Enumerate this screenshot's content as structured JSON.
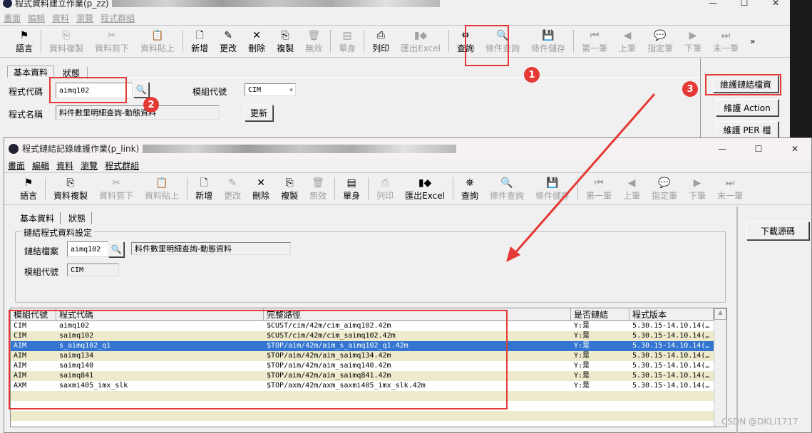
{
  "back_window": {
    "title": "程式資料建立作業(p_zz)",
    "menu": [
      "畫面",
      "編輯",
      "資料",
      "瀏覽",
      "程式群組"
    ],
    "toolbar": [
      {
        "icon": "flag-icon",
        "glyph": "⚑",
        "label": "語言",
        "enabled": true
      },
      {
        "sep": true
      },
      {
        "icon": "copy-data-icon",
        "glyph": "⎘",
        "label": "資料複製",
        "enabled": false
      },
      {
        "icon": "cut-icon",
        "glyph": "✂",
        "label": "資料剪下",
        "enabled": false
      },
      {
        "icon": "paste-icon",
        "glyph": "📋",
        "label": "資料貼上",
        "enabled": false
      },
      {
        "sep": true
      },
      {
        "icon": "new-icon",
        "glyph": "🗋",
        "label": "新增",
        "enabled": true
      },
      {
        "icon": "pencil-icon",
        "glyph": "✎",
        "label": "更改",
        "enabled": true
      },
      {
        "icon": "delete-icon",
        "glyph": "✕",
        "label": "刪除",
        "enabled": true
      },
      {
        "icon": "duplicate-icon",
        "glyph": "⎘",
        "label": "複製",
        "enabled": true
      },
      {
        "icon": "trash-icon",
        "glyph": "🗑",
        "label": "無效",
        "enabled": false
      },
      {
        "sep": true
      },
      {
        "icon": "form-icon",
        "glyph": "▤",
        "label": "單身",
        "enabled": false
      },
      {
        "sep": true
      },
      {
        "icon": "printer-icon",
        "glyph": "⎙",
        "label": "列印",
        "enabled": true
      },
      {
        "icon": "excel-export-icon",
        "glyph": "▮◆",
        "label": "匯出Excel",
        "enabled": false
      },
      {
        "sep": true
      },
      {
        "icon": "binoculars-icon",
        "glyph": "⛯",
        "label": "查詢",
        "enabled": true
      },
      {
        "icon": "condition-query-icon",
        "glyph": "🔍",
        "label": "條件查詢",
        "enabled": false
      },
      {
        "icon": "condition-save-icon",
        "glyph": "💾",
        "label": "條件儲存",
        "enabled": false
      },
      {
        "sep": true
      },
      {
        "icon": "first-record-icon",
        "glyph": "⏮",
        "label": "第一筆",
        "enabled": false
      },
      {
        "icon": "prev-record-icon",
        "glyph": "◀",
        "label": "上筆",
        "enabled": false
      },
      {
        "icon": "goto-record-icon",
        "glyph": "💬",
        "label": "指定筆",
        "enabled": false
      },
      {
        "icon": "next-record-icon",
        "glyph": "▶",
        "label": "下筆",
        "enabled": false
      },
      {
        "icon": "last-record-icon",
        "glyph": "⏭",
        "label": "末一筆",
        "enabled": false
      }
    ],
    "overflow": "»",
    "tabs": [
      "基本資料",
      "狀態"
    ],
    "program_code_label": "程式代碼",
    "program_code_value": "aimq102",
    "module_label": "模組代號",
    "module_value": "CIM",
    "program_name_label": "程式名稱",
    "program_name_value": "料件數里明細查詢-動態資料",
    "refresh_button": "更新",
    "side_buttons": [
      "維護鏈結檔資",
      "維護 Action",
      "維護 PER 檔"
    ]
  },
  "front_window": {
    "title": "程式鏈結記錄維護作業(p_link)",
    "menu": [
      "畫面",
      "編輯",
      "資料",
      "瀏覽",
      "程式群組"
    ],
    "toolbar": [
      {
        "icon": "flag-icon",
        "glyph": "⚑",
        "label": "語言",
        "enabled": true
      },
      {
        "sep": true
      },
      {
        "icon": "copy-data-icon",
        "glyph": "⎘",
        "label": "資料複製",
        "enabled": true
      },
      {
        "icon": "cut-icon",
        "glyph": "✂",
        "label": "資料剪下",
        "enabled": false
      },
      {
        "icon": "paste-icon",
        "glyph": "📋",
        "label": "資料貼上",
        "enabled": false
      },
      {
        "sep": true
      },
      {
        "icon": "new-icon",
        "glyph": "🗋",
        "label": "新增",
        "enabled": true
      },
      {
        "icon": "pencil-icon",
        "glyph": "✎",
        "label": "更改",
        "enabled": false
      },
      {
        "icon": "delete-icon",
        "glyph": "✕",
        "label": "刪除",
        "enabled": true
      },
      {
        "icon": "duplicate-icon",
        "glyph": "⎘",
        "label": "複製",
        "enabled": true
      },
      {
        "icon": "trash-icon",
        "glyph": "🗑",
        "label": "無效",
        "enabled": false
      },
      {
        "sep": true
      },
      {
        "icon": "form-icon",
        "glyph": "▤",
        "label": "單身",
        "enabled": true
      },
      {
        "sep": true
      },
      {
        "icon": "printer-icon",
        "glyph": "⎙",
        "label": "列印",
        "enabled": false
      },
      {
        "icon": "excel-export-icon",
        "glyph": "▮◆",
        "label": "匯出Excel",
        "enabled": true
      },
      {
        "sep": true
      },
      {
        "icon": "binoculars-icon",
        "glyph": "⛯",
        "label": "查詢",
        "enabled": true
      },
      {
        "icon": "condition-query-icon",
        "glyph": "🔍",
        "label": "條件查詢",
        "enabled": false
      },
      {
        "icon": "condition-save-icon",
        "glyph": "💾",
        "label": "條件儲存",
        "enabled": false
      },
      {
        "sep": true
      },
      {
        "icon": "first-record-icon",
        "glyph": "⏮",
        "label": "第一筆",
        "enabled": false
      },
      {
        "icon": "prev-record-icon",
        "glyph": "◀",
        "label": "上筆",
        "enabled": false
      },
      {
        "icon": "goto-record-icon",
        "glyph": "💬",
        "label": "指定筆",
        "enabled": false
      },
      {
        "icon": "next-record-icon",
        "glyph": "▶",
        "label": "下筆",
        "enabled": false
      },
      {
        "icon": "last-record-icon",
        "glyph": "⏭",
        "label": "末一筆",
        "enabled": false
      }
    ],
    "tabs": [
      "基本資料",
      "狀態"
    ],
    "group_title": "鏈結程式資料設定",
    "link_file_label": "鏈結檔案",
    "link_file_value": "aimq102",
    "link_file_name": "料件數里明細查詢-動態資料",
    "module_label": "模組代號",
    "module_value": "CIM",
    "download_button": "下載源碼",
    "grid": {
      "columns": [
        "模組代號",
        "程式代碼",
        "完整路徑",
        "是否鏈結",
        "程式版本"
      ],
      "rows": [
        [
          "CIM",
          "aimq102",
          "$CUST/cim/42m/cim_aimq102.42m",
          "Y:是",
          "5.30.15-14.10.14(…"
        ],
        [
          "CIM",
          "saimq102",
          "$CUST/cim/42m/cim_saimq102.42m",
          "Y:是",
          "5.30.15-14.10.14(…"
        ],
        [
          "AIM",
          "s_aimq102_q1",
          "$TOP/aim/42m/aim_s_aimq102_q1.42m",
          "Y:是",
          "5.30.15-14.10.14(…"
        ],
        [
          "AIM",
          "saimq134",
          "$TOP/aim/42m/aim_saimq134.42m",
          "Y:是",
          "5.30.15-14.10.14(…"
        ],
        [
          "AIM",
          "saimq140",
          "$TOP/aim/42m/aim_saimq140.42m",
          "Y:是",
          "5.30.15-14.10.14(…"
        ],
        [
          "AIM",
          "saimq841",
          "$TOP/aim/42m/aim_saimq841.42m",
          "Y:是",
          "5.30.15-14.10.14(…"
        ],
        [
          "AXM",
          "saxmi405_imx_slk",
          "$TOP/axm/42m/axm_saxmi405_imx_slk.42m",
          "Y:是",
          "5.30.15-14.10.14(…"
        ]
      ],
      "selected_row": 2
    }
  },
  "annotations": [
    "1",
    "2",
    "3"
  ],
  "watermark": "CSDN @DKLi1717",
  "colors": {
    "annotation": "#e53935",
    "selection": "#3375d0",
    "alt_row": "#eeeacc"
  }
}
